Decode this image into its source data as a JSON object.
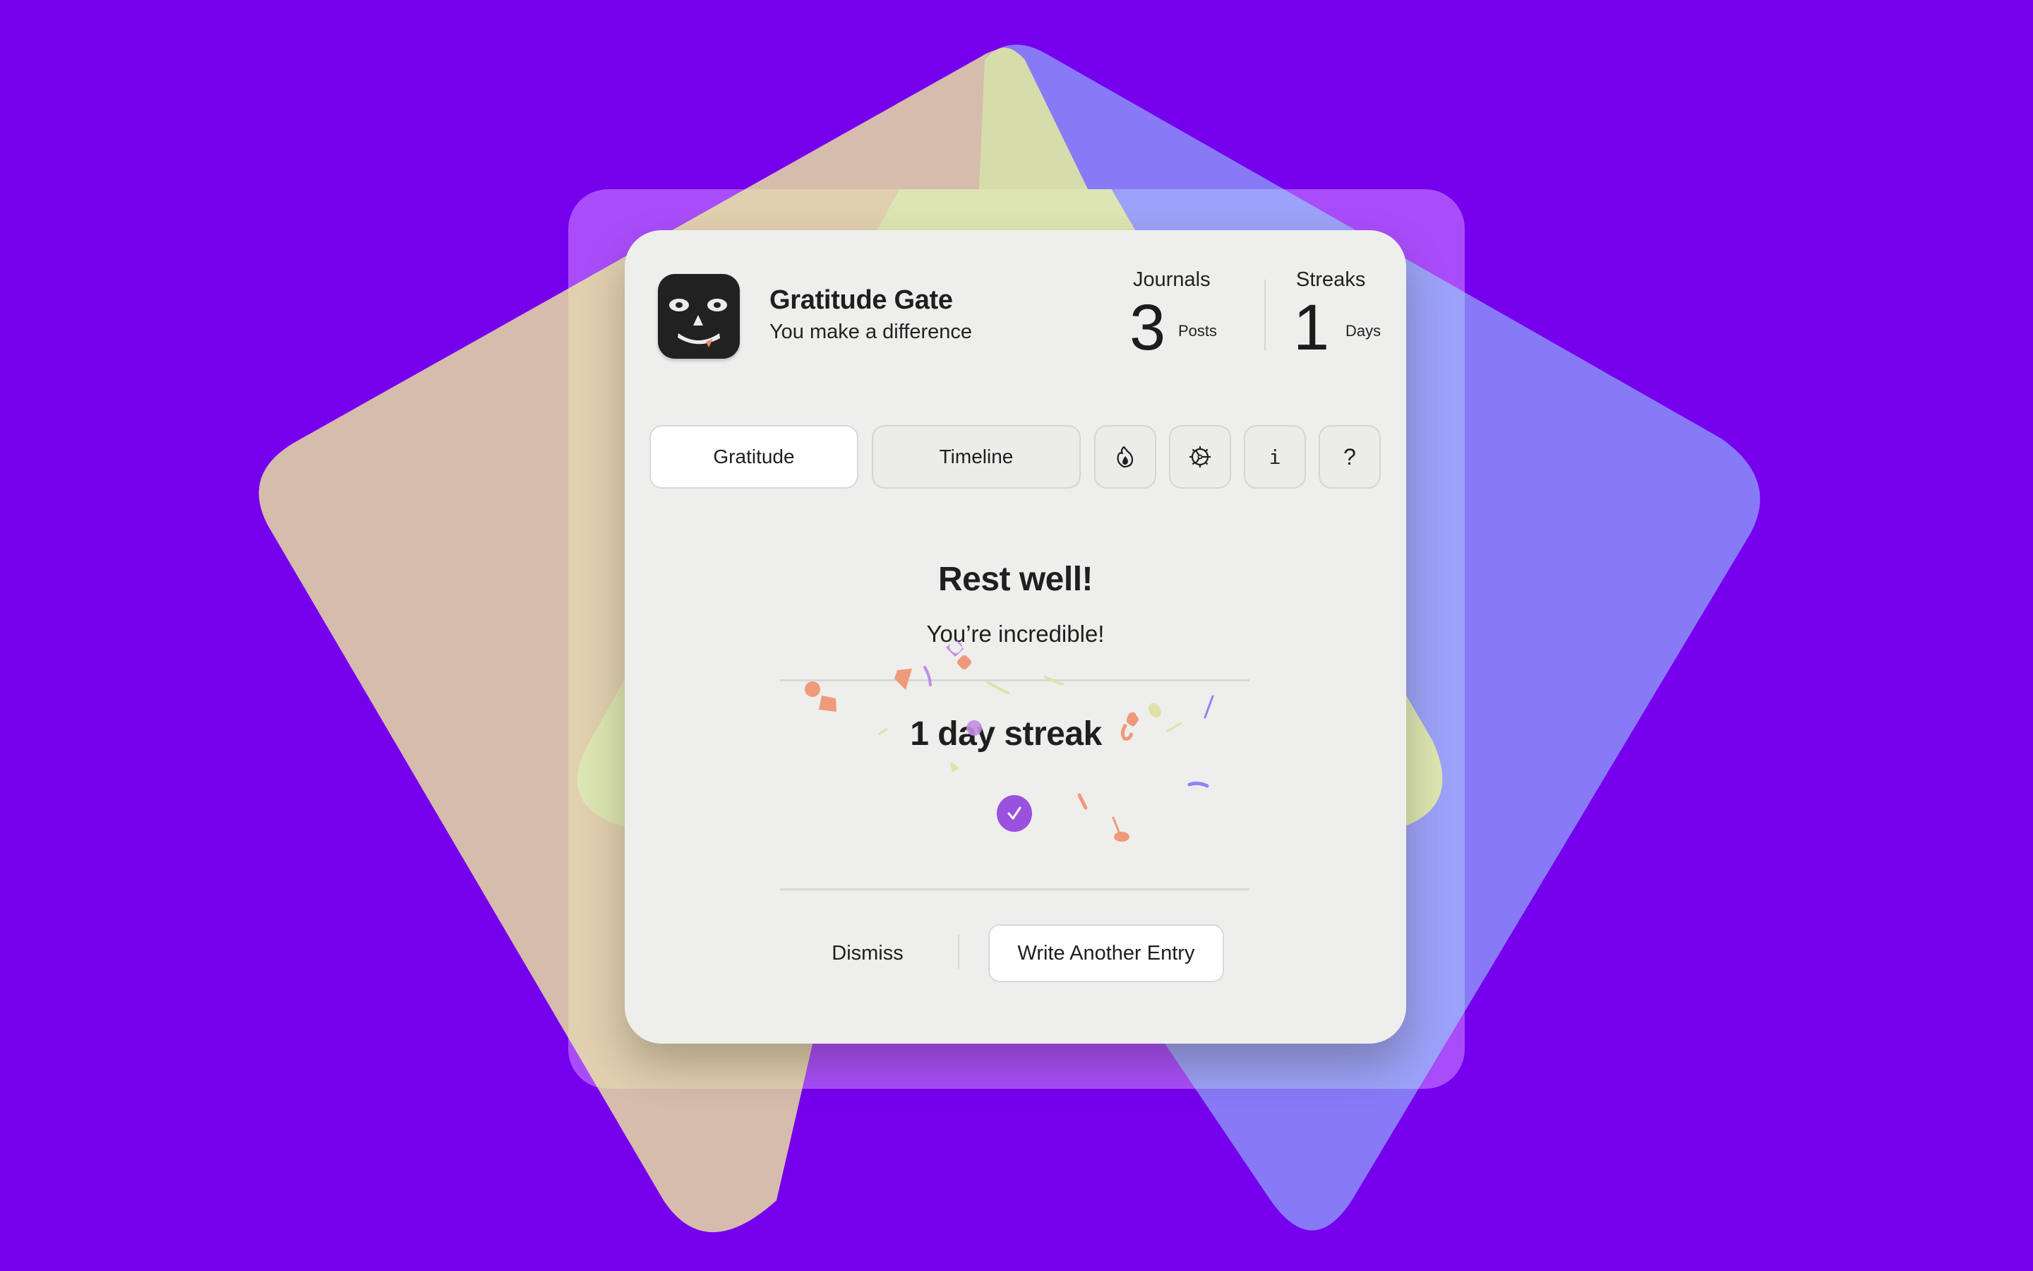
{
  "app": {
    "title": "Gratitude Gate",
    "subtitle": "You make a difference",
    "icon": "smiling-face-app-icon"
  },
  "stats": {
    "journals": {
      "label": "Journals",
      "value": "3",
      "unit": "Posts"
    },
    "streaks": {
      "label": "Streaks",
      "value": "1",
      "unit": "Days"
    }
  },
  "tabs": [
    {
      "label": "Gratitude",
      "active": true
    },
    {
      "label": "Timeline",
      "active": false
    },
    {
      "icon": "flame-icon",
      "label": ""
    },
    {
      "icon": "gear-icon",
      "label": ""
    },
    {
      "icon": "info-icon",
      "label": "i"
    },
    {
      "icon": "help-icon",
      "label": "?"
    }
  ],
  "message": {
    "headline": "Rest well!",
    "subline": "You’re incredible!",
    "streak": "1 day streak",
    "status_icon": "checkmark-icon"
  },
  "actions": {
    "dismiss": "Dismiss",
    "write_another": "Write Another Entry"
  },
  "colors": {
    "background": "#7600ee",
    "card": "#eeeeed",
    "accent_purple": "#9b51e0",
    "confetti_orange": "#ef9a78",
    "confetti_purple": "#c08ee0",
    "confetti_yellow": "#dfe2a8",
    "confetti_blue": "#8a85f8",
    "shape_peach": "#d6bcac",
    "shape_yellow": "#dde6b2",
    "shape_blue": "#8a7bf7"
  }
}
